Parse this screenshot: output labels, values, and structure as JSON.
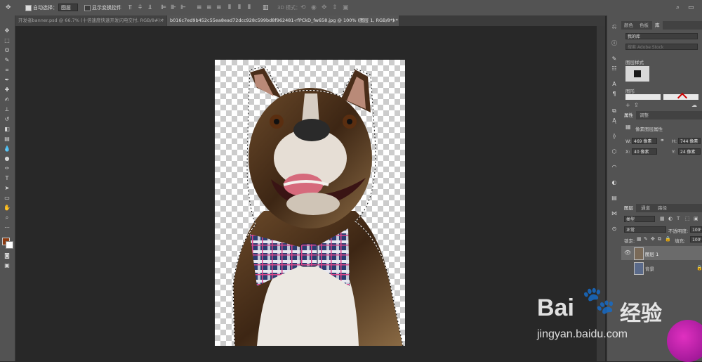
{
  "options_bar": {
    "auto_select_label": "自动选择：",
    "auto_select_value": "图层",
    "show_transform_label": "显示变换控件",
    "mode_3d_label": "3D 模式："
  },
  "tabs": [
    {
      "label": "开发者banner.psd @ 66.7% (十倍速度快速开发闪电交付, RGB/8#) *",
      "close": "×"
    },
    {
      "label": "b016c7ed9b452c55ea8ead72dcc928c599bd8f962481-rfPCkD_fw658.jpg @ 100% (图层 1, RGB/8*) *",
      "close": "×"
    }
  ],
  "right_panel": {
    "top_tabs": [
      "颜色",
      "色板",
      "库"
    ],
    "library_select": "我的库",
    "library_search_placeholder": "搜索 Adobe Stock",
    "layer_styles_label": "图层样式",
    "graphics_label": "图形",
    "props_tabs": [
      "属性",
      "调整"
    ],
    "pixel_layer_props": "像素图层属性",
    "w_label": "W:",
    "w_value": "469 像素",
    "h_label": "H:",
    "h_value": "744 像素",
    "x_label": "X:",
    "x_value": "40 像素",
    "y_label": "Y:",
    "y_value": "24 像素",
    "layers_tabs": [
      "图层",
      "通道",
      "路径"
    ],
    "kind_select": "类型",
    "blend_mode": "正常",
    "opacity_label": "不透明度:",
    "opacity_value": "100%",
    "lock_label": "锁定:",
    "fill_label": "填充:",
    "fill_value": "100%",
    "layers": [
      {
        "name": "图层 1",
        "visible": true,
        "selected": true
      },
      {
        "name": "背景",
        "visible": false,
        "selected": false
      }
    ]
  },
  "watermark": {
    "brand_text": "Bai",
    "brand_text2": "经验",
    "url": "jingyan.baidu.com"
  },
  "colors": {
    "foreground": "#8b3a10",
    "background": "#ffffff"
  }
}
